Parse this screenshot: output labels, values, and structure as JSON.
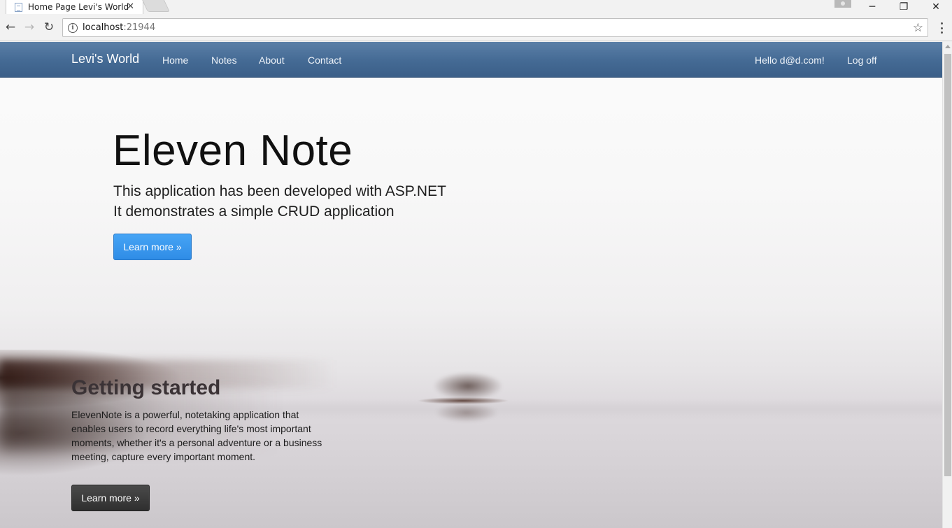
{
  "browser": {
    "tab_title": "Home Page Levi's World",
    "tab_close": "✕",
    "url_host": "localhost",
    "url_port": ":21944",
    "window_controls": {
      "minimize": "─",
      "restore": "❐",
      "close": "✕"
    }
  },
  "navbar": {
    "brand": "Levi's World",
    "links": [
      "Home",
      "Notes",
      "About",
      "Contact"
    ],
    "greeting": "Hello d@d.com!",
    "logoff": "Log off",
    "background_color": "#446a94"
  },
  "hero": {
    "title": "Eleven Note",
    "line1": "This application has been developed with ASP.NET",
    "line2": "It demonstrates a simple CRUD application",
    "button": "Learn more »",
    "button_color": "#2f8ce6"
  },
  "getting_started": {
    "title": "Getting started",
    "text": "ElevenNote is a powerful, notetaking application that enables users to record everything life's most important moments, whether it's a personal adventure or a business meeting, capture every important moment.",
    "button": "Learn more »",
    "button_color": "#333333"
  },
  "icons": {
    "back": "arrow-left-icon",
    "forward": "arrow-right-icon",
    "reload": "reload-icon",
    "info": "info-icon",
    "bookmark": "star-icon",
    "menu": "three-dots-icon"
  }
}
